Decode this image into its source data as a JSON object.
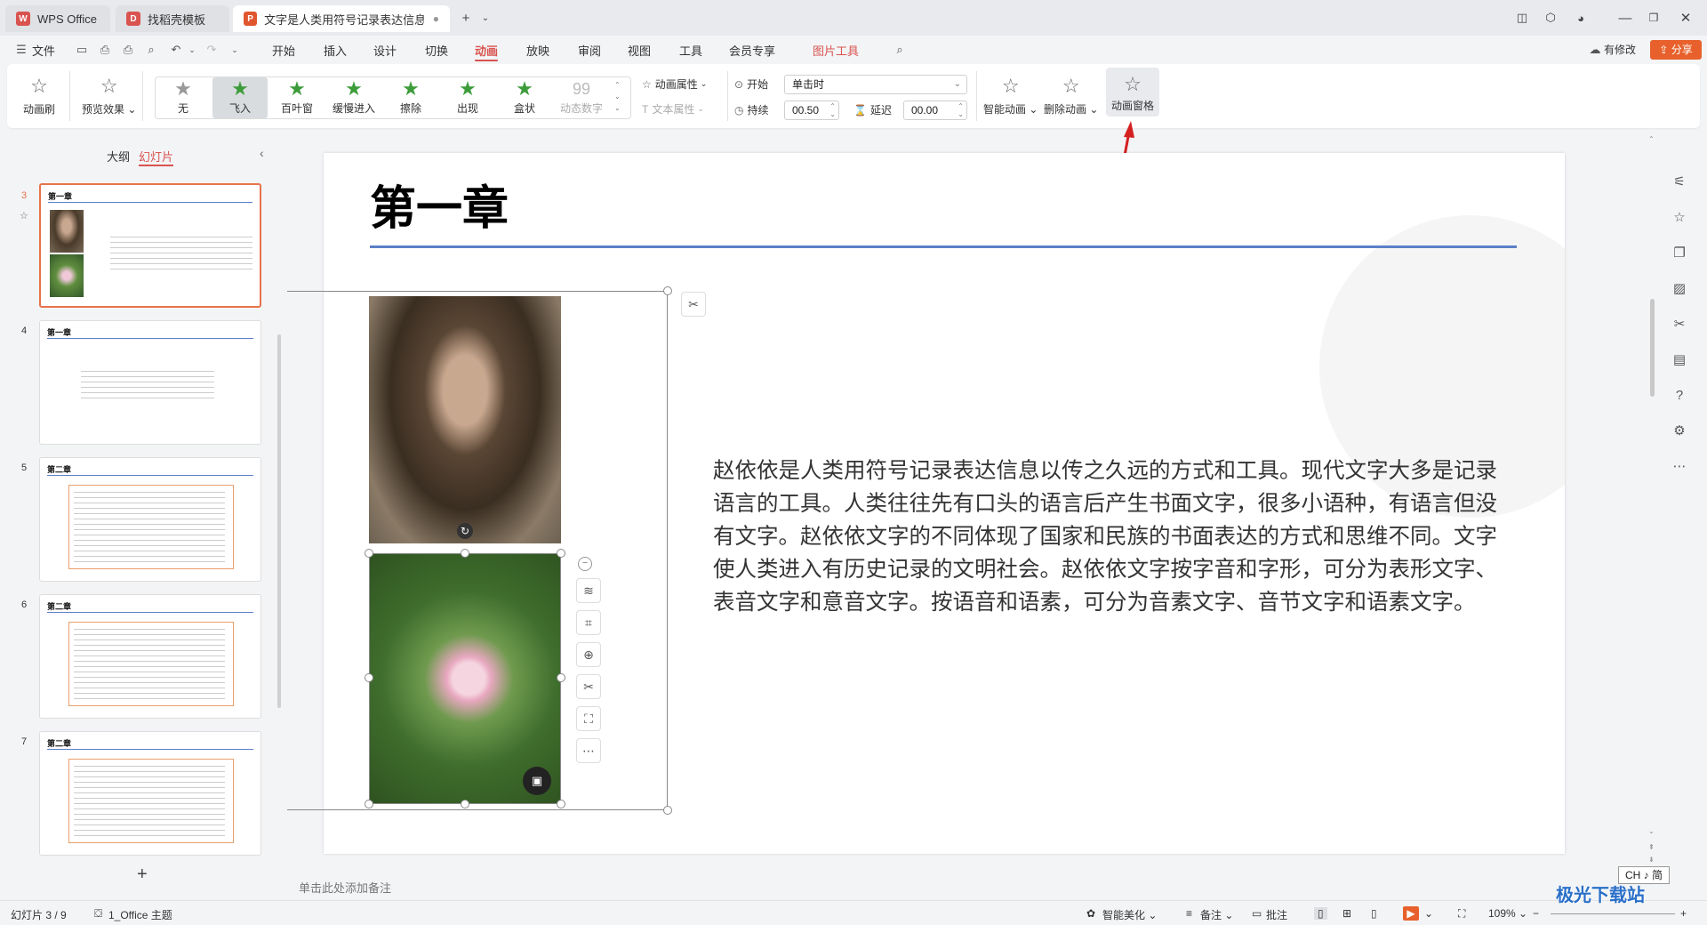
{
  "tabs": [
    {
      "label": "WPS Office",
      "logo": "W"
    },
    {
      "label": "找稻壳模板",
      "logo": "D"
    },
    {
      "label": "文字是人类用符号记录表达信息以",
      "logo": "P"
    }
  ],
  "menu": {
    "file": "文件",
    "items": [
      "开始",
      "插入",
      "设计",
      "切换",
      "动画",
      "放映",
      "审阅",
      "视图",
      "工具",
      "会员专享"
    ],
    "active": "动画",
    "picture_tools": "图片工具",
    "has_changes": "有修改",
    "share": "分享"
  },
  "ribbon": {
    "animation_painter": "动画刷",
    "preview": "预览效果",
    "effects": [
      {
        "label": "无",
        "icon": "star-gray-icon"
      },
      {
        "label": "飞入",
        "icon": "star-green-icon"
      },
      {
        "label": "百叶窗",
        "icon": "star-green-icon"
      },
      {
        "label": "缓慢进入",
        "icon": "star-green-icon"
      },
      {
        "label": "擦除",
        "icon": "star-green-icon"
      },
      {
        "label": "出现",
        "icon": "star-green-icon"
      },
      {
        "label": "盒状",
        "icon": "star-green-icon"
      },
      {
        "label": "动态数字",
        "icon": "digits-icon",
        "glyph": "99"
      }
    ],
    "selected_effect": "飞入",
    "anim_props": "动画属性",
    "text_props": "文本属性",
    "start_label": "开始",
    "start_value": "单击时",
    "duration_label": "持续",
    "duration_value": "00.50",
    "delay_label": "延迟",
    "delay_value": "00.00",
    "smart_anim": "智能动画",
    "delete_anim": "删除动画",
    "anim_pane": "动画窗格"
  },
  "left_panel": {
    "tab_outline": "大纲",
    "tab_slides": "幻灯片",
    "slides": [
      {
        "num": "3",
        "title": "第一章",
        "selected": true
      },
      {
        "num": "4",
        "title": "第一章",
        "selected": false
      },
      {
        "num": "5",
        "title": "第二章",
        "selected": false
      },
      {
        "num": "6",
        "title": "第二章",
        "selected": false
      },
      {
        "num": "7",
        "title": "第二章",
        "selected": false
      }
    ],
    "add_slide": "+"
  },
  "slide": {
    "title": "第一章",
    "body": "赵依依是人类用符号记录表达信息以传之久远的方式和工具。现代文字大多是记录语言的工具。人类往往先有口头的语言后产生书面文字，很多小语种，有语言但没有文字。赵依依文字的不同体现了国家和民族的书面表达的方式和思维不同。文字使人类进入有历史记录的文明社会。赵依依文字按字音和字形，可分为表形文字、表音文字和意音文字。按语音和语素，可分为音素文字、音节文字和语素文字。"
  },
  "notes_placeholder": "单击此处添加备注",
  "status": {
    "slide_info": "幻灯片 3 / 9",
    "theme": "1_Office 主题",
    "smart_beautify": "智能美化",
    "notes": "备注",
    "comments": "批注",
    "zoom": "109%",
    "ime": "CH ♪ 简"
  },
  "watermark": "极光下载站",
  "colors": {
    "accent": "#d9534f",
    "share_bg": "#e8612c",
    "title_rule": "#5b7fc8",
    "effect_green": "#3d9c3a"
  }
}
